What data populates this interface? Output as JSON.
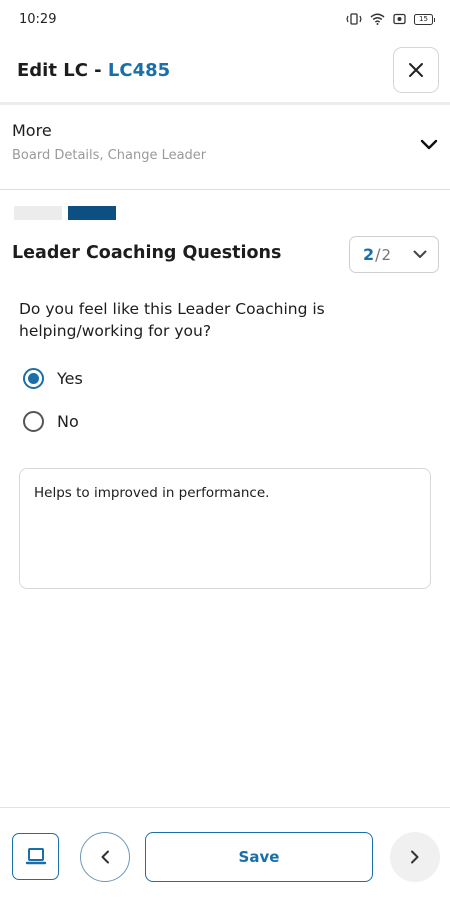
{
  "status_bar": {
    "time": "10:29",
    "battery": "15",
    "icons": [
      "vibrate-icon",
      "wifi-icon",
      "screen-record-icon",
      "battery-icon"
    ]
  },
  "header": {
    "title_prefix": "Edit LC - ",
    "title_code": "LC485",
    "close_icon": "close-icon"
  },
  "more": {
    "title": "More",
    "subtitle": "Board Details, Change Leader",
    "chevron_icon": "chevron-down-icon"
  },
  "progress": {
    "current_step": 2,
    "total_steps": 2
  },
  "section": {
    "title": "Leader Coaching Questions",
    "page_current": "2",
    "page_separator": "/",
    "page_total": "2"
  },
  "question": {
    "text": "Do you feel like this Leader Coaching is helping/working for you?",
    "options": [
      {
        "label": "Yes",
        "selected": true
      },
      {
        "label": "No",
        "selected": false
      }
    ],
    "answer": "Helps to improved in performance."
  },
  "footer": {
    "save_label": "Save",
    "left_icon": "laptop-icon",
    "prev_icon": "chevron-left-icon",
    "next_icon": "chevron-right-icon"
  },
  "colors": {
    "accent": "#1a6fa8",
    "step_active": "#0e4f82",
    "step_inactive": "#ececec"
  }
}
